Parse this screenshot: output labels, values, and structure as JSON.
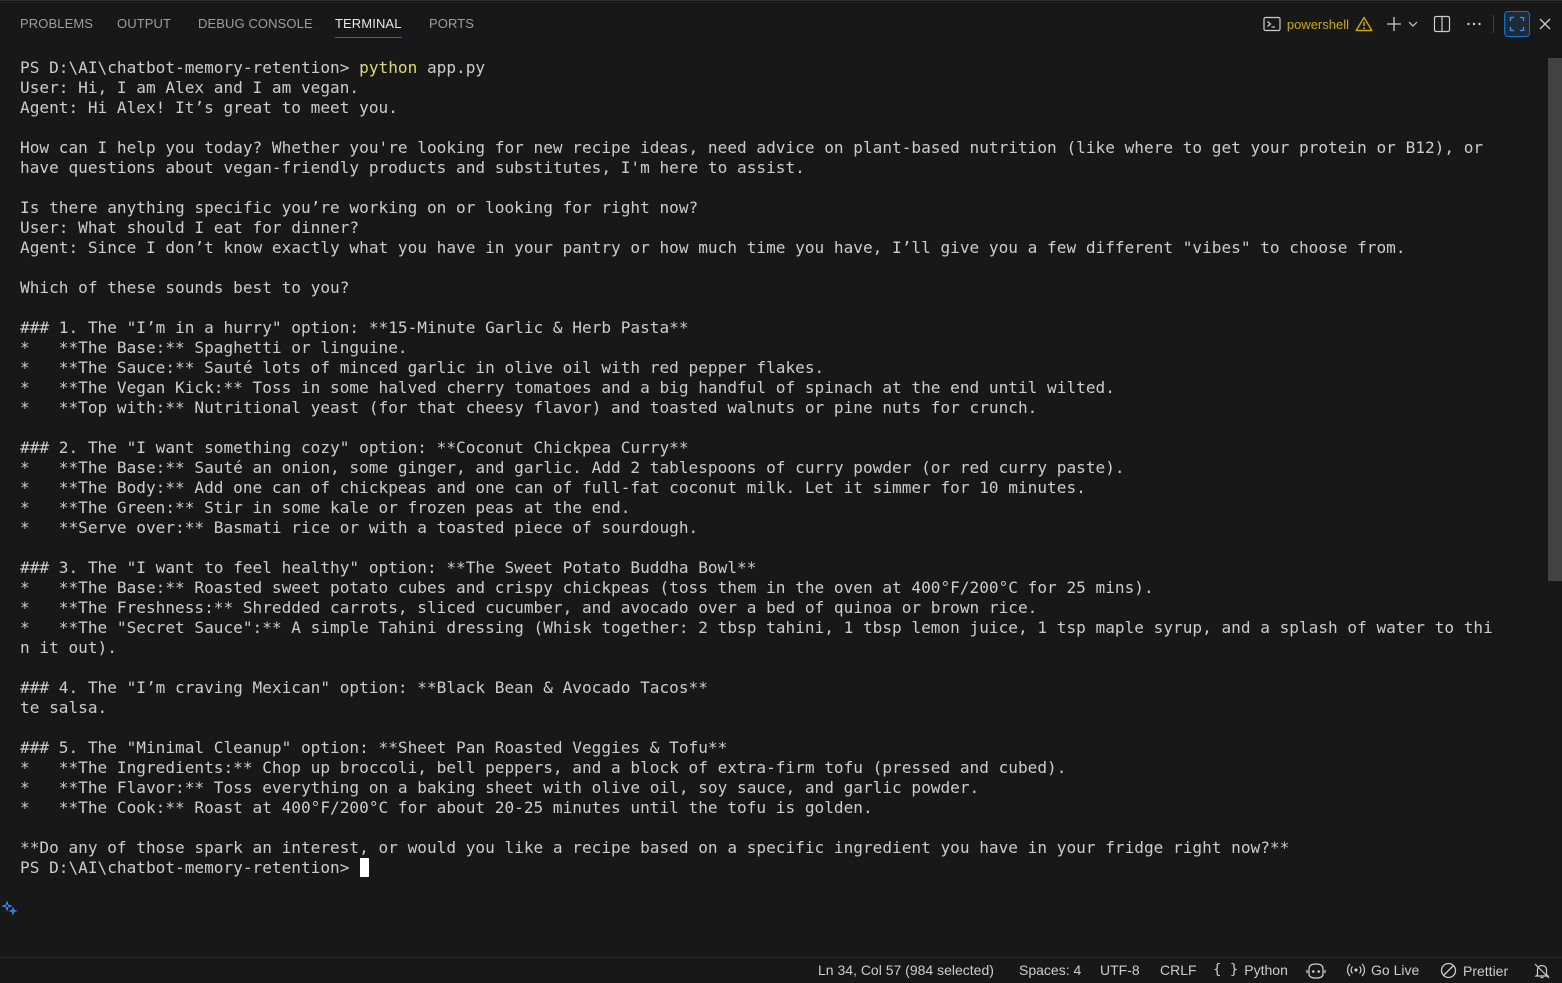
{
  "tabs": [
    {
      "label": "PROBLEMS"
    },
    {
      "label": "OUTPUT"
    },
    {
      "label": "DEBUG CONSOLE"
    },
    {
      "label": "TERMINAL",
      "active": true
    },
    {
      "label": "PORTS"
    }
  ],
  "terminal_name": "powershell",
  "terminal_lines": {
    "l01": "User: Hi, I am Alex and I am vegan.",
    "l02": "Agent: Hi Alex! It’s great to meet you.",
    "l03": "",
    "l04": "How can I help you today? Whether you're looking for new recipe ideas, need advice on plant-based nutrition (like where to get your protein or B12), or",
    "l05": "have questions about vegan-friendly products and substitutes, I'm here to assist.",
    "l06": "",
    "l07": "Is there anything specific you’re working on or looking for right now?",
    "l08": "User: What should I eat for dinner?",
    "l09": "Agent: Since I don’t know exactly what you have in your pantry or how much time you have, I’ll give you a few different \"vibes\" to choose from.",
    "l10": "",
    "l11": "Which of these sounds best to you?",
    "l12": "",
    "l13": "### 1. The \"I’m in a hurry\" option: **15-Minute Garlic & Herb Pasta**",
    "l14": "*   **The Base:** Spaghetti or linguine.",
    "l15": "*   **The Sauce:** Sauté lots of minced garlic in olive oil with red pepper flakes.",
    "l16": "*   **The Vegan Kick:** Toss in some halved cherry tomatoes and a big handful of spinach at the end until wilted.",
    "l17": "*   **Top with:** Nutritional yeast (for that cheesy flavor) and toasted walnuts or pine nuts for crunch.",
    "l18": "",
    "l19": "### 2. The \"I want something cozy\" option: **Coconut Chickpea Curry**",
    "l20": "*   **The Base:** Sauté an onion, some ginger, and garlic. Add 2 tablespoons of curry powder (or red curry paste).",
    "l21": "*   **The Body:** Add one can of chickpeas and one can of full-fat coconut milk. Let it simmer for 10 minutes.",
    "l22": "*   **The Green:** Stir in some kale or frozen peas at the end.",
    "l23": "*   **Serve over:** Basmati rice or with a toasted piece of sourdough.",
    "l24": "",
    "l25": "### 3. The \"I want to feel healthy\" option: **The Sweet Potato Buddha Bowl**",
    "l26": "*   **The Base:** Roasted sweet potato cubes and crispy chickpeas (toss them in the oven at 400°F/200°C for 25 mins).",
    "l27": "*   **The Freshness:** Shredded carrots, sliced cucumber, and avocado over a bed of quinoa or brown rice.",
    "l28": "*   **The \"Secret Sauce\":** A simple Tahini dressing (Whisk together: 2 tbsp tahini, 1 tbsp lemon juice, 1 tsp maple syrup, and a splash of water to thi",
    "l29": "n it out).",
    "l30": "",
    "l31": "### 4. The \"I’m craving Mexican\" option: **Black Bean & Avocado Tacos**",
    "l32": "te salsa.",
    "l33": "",
    "l34": "### 5. The \"Minimal Cleanup\" option: **Sheet Pan Roasted Veggies & Tofu**",
    "l35": "*   **The Ingredients:** Chop up broccoli, bell peppers, and a block of extra-firm tofu (pressed and cubed).",
    "l36": "*   **The Flavor:** Toss everything on a baking sheet with olive oil, soy sauce, and garlic powder.",
    "l37": "*   **The Cook:** Roast at 400°F/200°C for about 20-25 minutes until the tofu is golden.",
    "l38": "",
    "l39": "**Do any of those spark an interest, or would you like a recipe based on a specific ingredient you have in your fridge right now?**"
  },
  "prompt": "PS D:\\AI\\chatbot-memory-retention> ",
  "command": "python",
  "command_arg": " app.py",
  "status": {
    "position": "Ln 34, Col 57 (984 selected)",
    "spaces": "Spaces: 4",
    "encoding": "UTF-8",
    "eol": "CRLF",
    "language": "Python",
    "go_live": "Go Live",
    "prettier": "Prettier"
  },
  "colors": {
    "accent": "#0078d4",
    "warning": "#cca700",
    "background": "#181818"
  }
}
